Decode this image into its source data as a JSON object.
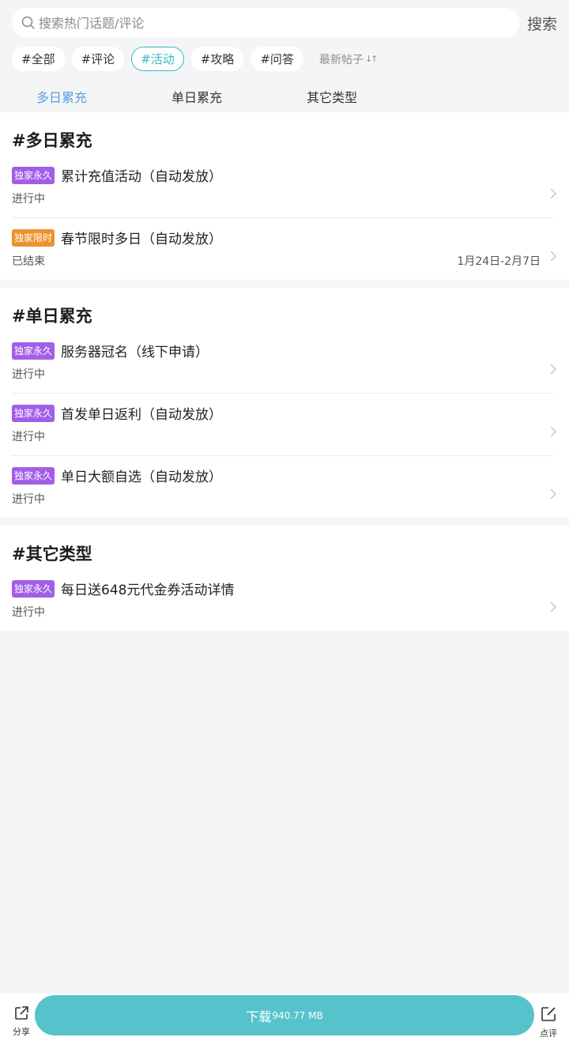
{
  "search": {
    "placeholder": "搜索热门话题/评论",
    "button": "搜索"
  },
  "chips": [
    "#全部",
    "#评论",
    "#活动",
    "#攻略",
    "#问答"
  ],
  "sort": {
    "label": "最新帖子",
    "icon": "sort-arrows-icon"
  },
  "tabs": [
    "多日累充",
    "单日累充",
    "其它类型"
  ],
  "sections": [
    {
      "title": "#多日累充",
      "items": [
        {
          "badge": "独家永久",
          "name": "累计充值活动（自动发放）",
          "status": "进行中",
          "date": ""
        },
        {
          "badge": "独家限时",
          "name": "春节限时多日（自动发放）",
          "status": "已结束",
          "date": "1月24日-2月7日"
        }
      ]
    },
    {
      "title": "#单日累充",
      "items": [
        {
          "badge": "独家永久",
          "name": "服务器冠名（线下申请）",
          "status": "进行中",
          "date": ""
        },
        {
          "badge": "独家永久",
          "name": "首发单日返利（自动发放）",
          "status": "进行中",
          "date": ""
        },
        {
          "badge": "独家永久",
          "name": "单日大额自选（自动发放）",
          "status": "进行中",
          "date": ""
        }
      ]
    },
    {
      "title": "#其它类型",
      "items": [
        {
          "badge": "独家永久",
          "name": "每日送648元代金券活动详情",
          "status": "进行中",
          "date": ""
        }
      ]
    }
  ],
  "bottom": {
    "share": "分享",
    "download": "下载",
    "size": "940.77 MB",
    "review": "点评"
  },
  "colors": {
    "accent": "#56c3cc",
    "tab_active": "#5b9ee0",
    "badge_permanent": "#a25ee8",
    "badge_limited": "#ec922e"
  }
}
